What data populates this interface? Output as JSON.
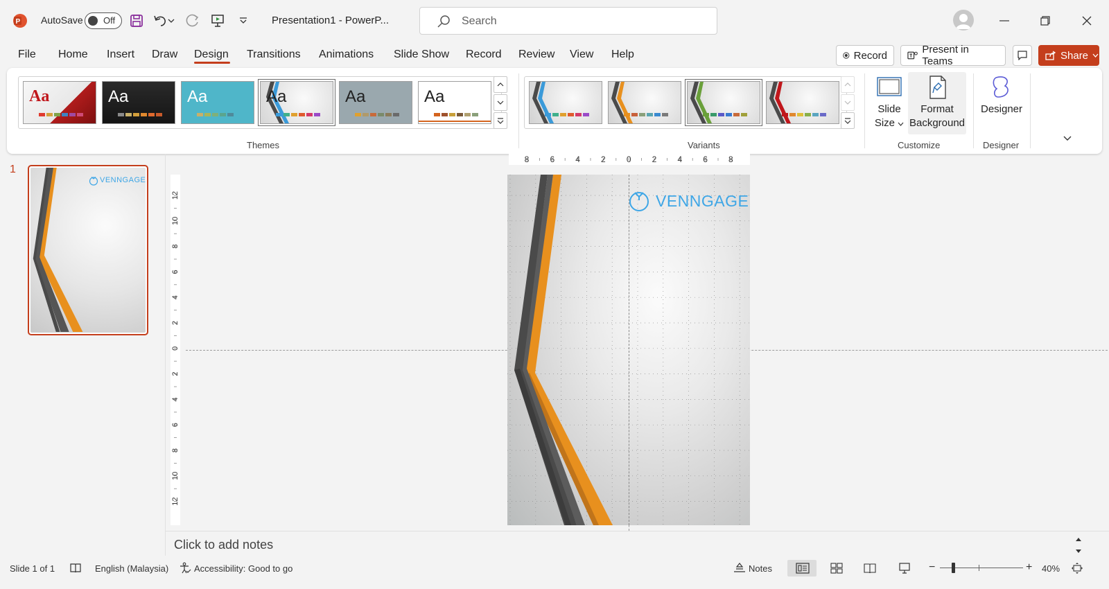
{
  "titlebar": {
    "autosave_label": "AutoSave",
    "autosave_state": "Off",
    "doc_title": "Presentation1  -  PowerP...",
    "search_placeholder": "Search"
  },
  "tabs": [
    "File",
    "Home",
    "Insert",
    "Draw",
    "Design",
    "Transitions",
    "Animations",
    "Slide Show",
    "Record",
    "Review",
    "View",
    "Help"
  ],
  "active_tab": "Design",
  "header_buttons": {
    "record": "Record",
    "present_in_teams": "Present in Teams",
    "share": "Share"
  },
  "ribbon": {
    "themes_label": "Themes",
    "variants_label": "Variants",
    "customize_label": "Customize",
    "designer_group_label": "Designer",
    "slide_size_line1": "Slide",
    "slide_size_line2": "Size",
    "format_bg_line1": "Format",
    "format_bg_line2": "Background",
    "designer_button": "Designer",
    "theme_sample_text": "Aa"
  },
  "slides_pane": {
    "slide_number": "1",
    "thumb_logo": "VENNGAGE"
  },
  "slide": {
    "logo_text": "VENNGAGE"
  },
  "rulers": {
    "horizontal": [
      "8",
      "6",
      "4",
      "2",
      "0",
      "2",
      "4",
      "6",
      "8"
    ],
    "vertical": [
      "12",
      "10",
      "8",
      "6",
      "4",
      "2",
      "0",
      "2",
      "4",
      "6",
      "8",
      "10",
      "12"
    ]
  },
  "notes": {
    "placeholder": "Click to add notes"
  },
  "statusbar": {
    "slide_info": "Slide 1 of 1",
    "language": "English (Malaysia)",
    "accessibility": "Accessibility: Good to go",
    "notes": "Notes",
    "zoom": "40%"
  },
  "colors": {
    "accent": "#c43e1c",
    "logo_blue": "#3ea6e6",
    "stripe_orange": "#e8901e",
    "stripe_dark": "#4a4a4a"
  }
}
